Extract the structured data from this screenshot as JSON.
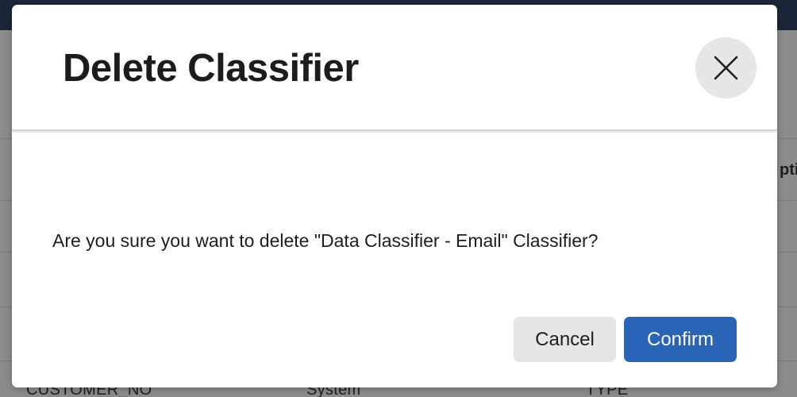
{
  "background": {
    "table_cells": [
      "CUSTOMER_NO",
      "System",
      "TYPE"
    ],
    "header_fragment": "pti"
  },
  "dialog": {
    "title": "Delete Classifier",
    "close_icon": "close-icon",
    "message": "Are you sure you want to delete \"Data Classifier - Email\" Classifier?",
    "cancel_label": "Cancel",
    "confirm_label": "Confirm"
  },
  "colors": {
    "top_bar": "#1b2638",
    "overlay": "#8c8c8c",
    "confirm_button": "#2a64b7",
    "cancel_button": "#e6e6e6",
    "close_button": "#e6e6e6"
  }
}
